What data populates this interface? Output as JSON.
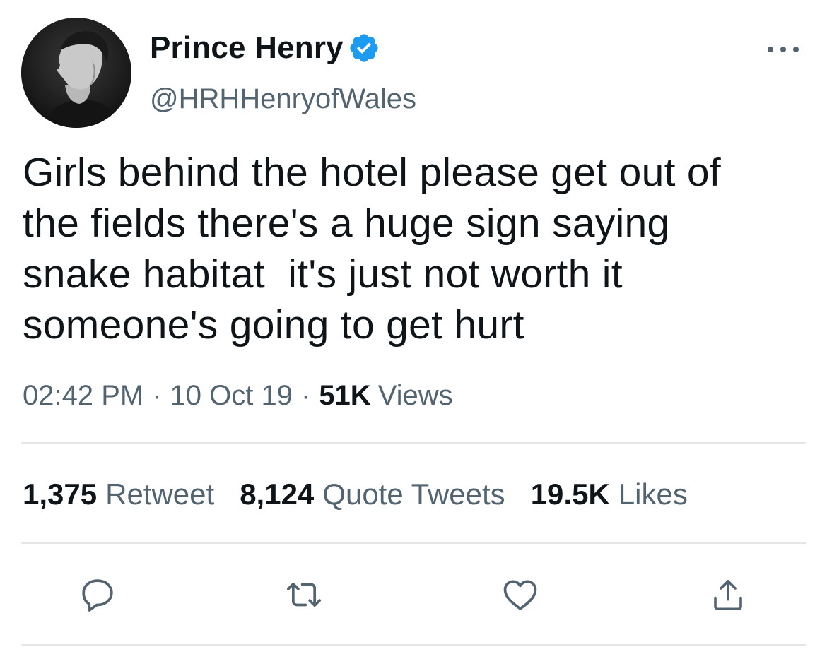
{
  "tweet": {
    "author": {
      "display_name": "Prince Henry",
      "handle": "@HRHHenryofWales",
      "verified": true,
      "avatar_icon": "profile-photo"
    },
    "more_icon": "more-options-icon",
    "text": "Girls behind the hotel please get out of\nthe fields there's a huge sign saying\nsnake habitat  it's just not worth it\nsomeone's going to get hurt",
    "meta": {
      "time": "02:42 PM",
      "separator": "·",
      "date": "10 Oct 19",
      "views_count": "51K",
      "views_label": "Views"
    },
    "stats": [
      {
        "count": "1,375",
        "label": "Retweet"
      },
      {
        "count": "8,124",
        "label": "Quote Tweets"
      },
      {
        "count": "19.5K",
        "label": "Likes"
      }
    ],
    "actions": [
      {
        "name": "reply",
        "icon": "reply-icon"
      },
      {
        "name": "retweet",
        "icon": "retweet-icon"
      },
      {
        "name": "like",
        "icon": "heart-icon"
      },
      {
        "name": "share",
        "icon": "share-icon"
      }
    ]
  },
  "colors": {
    "verified_blue": "#1d9bf0",
    "text_primary": "#0f1419",
    "text_secondary": "#536471",
    "divider": "#e4e7ea"
  }
}
